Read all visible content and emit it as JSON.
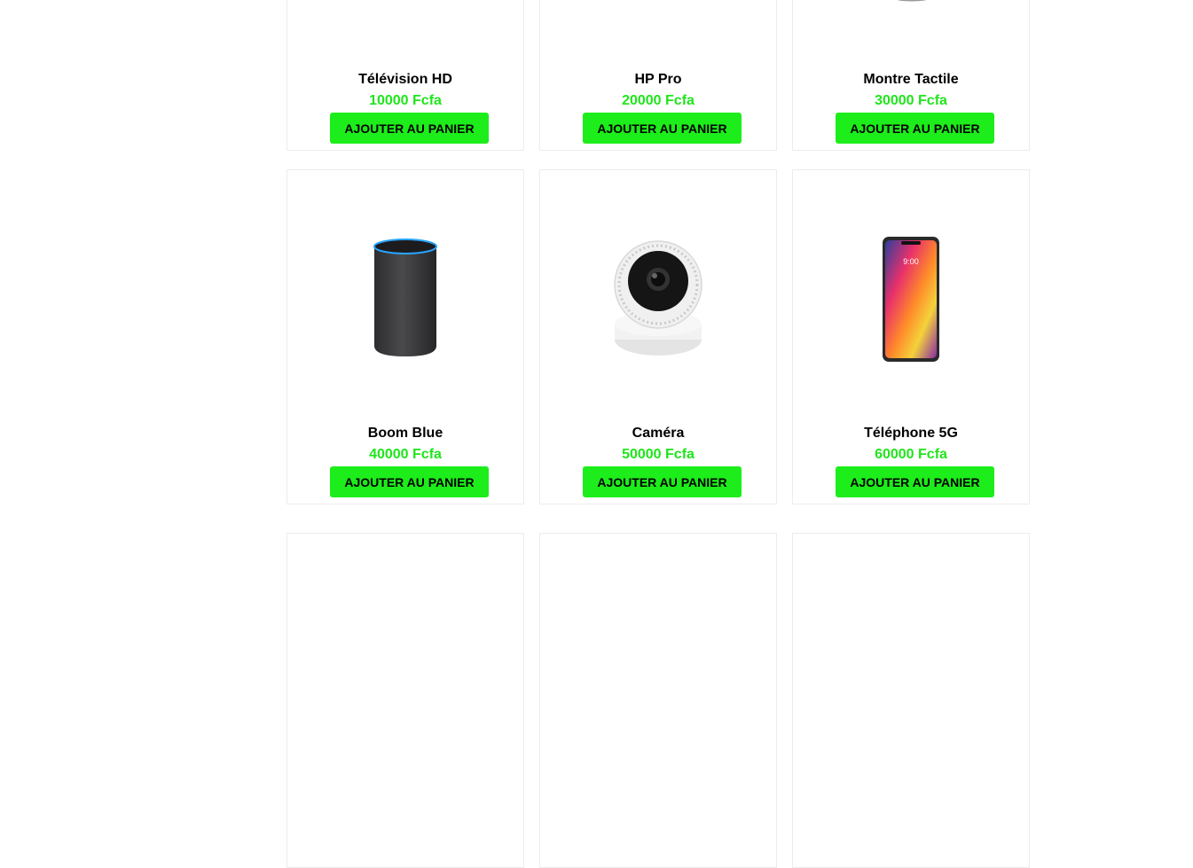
{
  "colors": {
    "accent": "#1ded1a",
    "price": "#1fe51b",
    "border": "#ececec"
  },
  "products": [
    {
      "name": "Télévision HD",
      "price": "10000 Fcfa",
      "button": "AJOUTER AU PANIER",
      "icon": "tv-image"
    },
    {
      "name": "HP Pro",
      "price": "20000 Fcfa",
      "button": "AJOUTER AU PANIER",
      "icon": "laptop-image"
    },
    {
      "name": "Montre Tactile",
      "price": "30000 Fcfa",
      "button": "AJOUTER AU PANIER",
      "icon": "watch-image"
    },
    {
      "name": "Boom Blue",
      "price": "40000 Fcfa",
      "button": "AJOUTER AU PANIER",
      "icon": "speaker-image"
    },
    {
      "name": "Caméra",
      "price": "50000 Fcfa",
      "button": "AJOUTER AU PANIER",
      "icon": "camera-image"
    },
    {
      "name": "Téléphone 5G",
      "price": "60000 Fcfa",
      "button": "AJOUTER AU PANIER",
      "icon": "phone-image"
    }
  ]
}
